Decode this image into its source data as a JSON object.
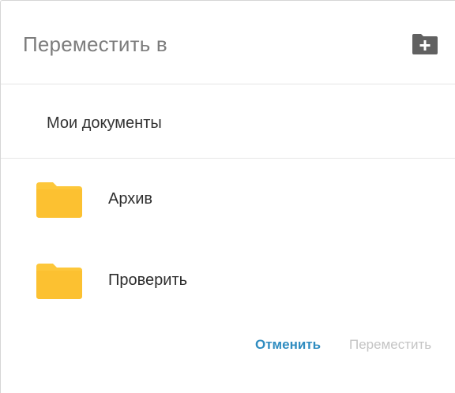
{
  "dialog": {
    "title": "Переместить в",
    "new_folder_icon": "folder-plus-icon"
  },
  "breadcrumb": {
    "current": "Мои документы"
  },
  "folders": [
    {
      "label": "Архив",
      "icon": "folder-icon"
    },
    {
      "label": "Проверить",
      "icon": "folder-icon"
    }
  ],
  "actions": {
    "cancel_label": "Отменить",
    "move_label": "Переместить",
    "move_enabled": false
  },
  "colors": {
    "accent": "#2f8cc0",
    "folder": "#fdc73a",
    "disabled": "#c4c4c4",
    "title": "#7c7c7c"
  }
}
